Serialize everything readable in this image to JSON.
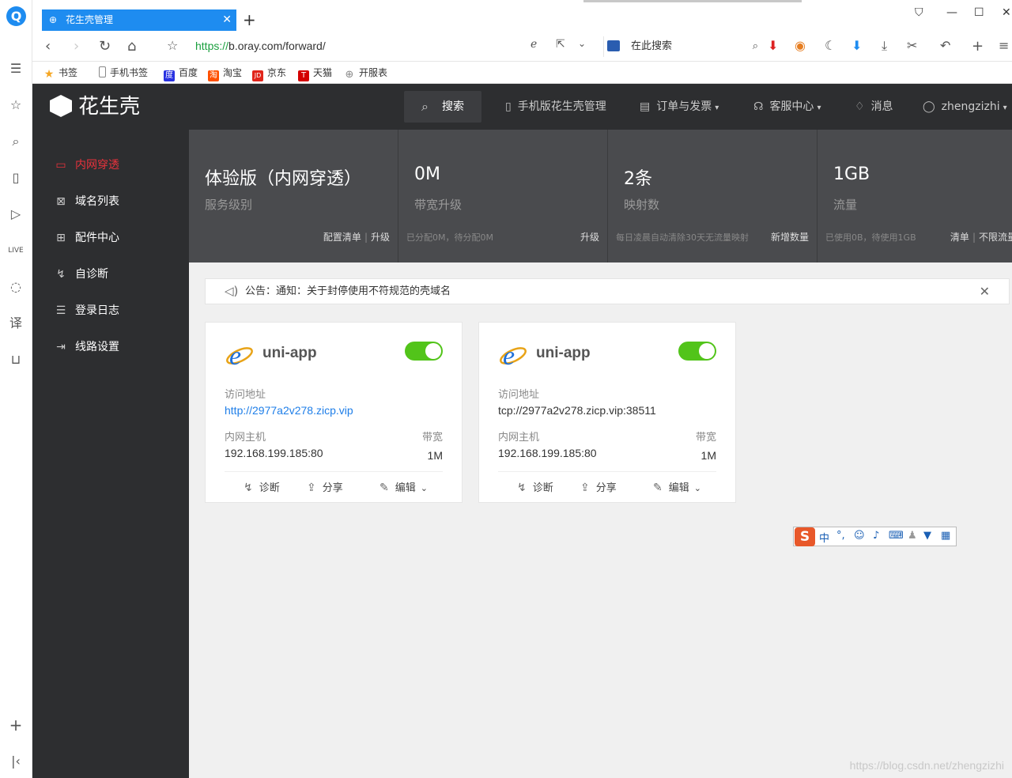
{
  "browser": {
    "tab_title": "花生壳管理",
    "url_scheme": "https://",
    "url_rest": "b.oray.com/forward/",
    "search_placeholder": "在此搜索",
    "bookmarks": [
      {
        "label": "书签",
        "icon": "star-icon",
        "color": "#f5a623"
      },
      {
        "label": "手机书签",
        "icon": "phone-icon",
        "color": "#888888"
      },
      {
        "label": "百度",
        "icon": "baidu-icon",
        "color": "#2932e1"
      },
      {
        "label": "淘宝",
        "icon": "taobao-icon",
        "color": "#ff5000"
      },
      {
        "label": "京东",
        "icon": "jd-icon",
        "color": "#e1251b"
      },
      {
        "label": "天猫",
        "icon": "tmall-icon",
        "color": "#d40000"
      },
      {
        "label": "开服表",
        "icon": "globe-icon",
        "color": "#888888"
      }
    ]
  },
  "header": {
    "brand": "花生壳",
    "search_label": "搜索",
    "items": [
      {
        "label": "手机版花生壳管理",
        "icon": "mobile-icon"
      },
      {
        "label": "订单与发票",
        "icon": "order-icon",
        "dropdown": true
      },
      {
        "label": "客服中心",
        "icon": "headset-icon",
        "dropdown": true
      },
      {
        "label": "消息",
        "icon": "bell-icon"
      },
      {
        "label": "zhengzizhi",
        "icon": "user-icon",
        "dropdown": true
      }
    ]
  },
  "sidebar": {
    "items": [
      {
        "label": "内网穿透",
        "icon": "monitor-icon",
        "active": true
      },
      {
        "label": "域名列表",
        "icon": "domain-icon",
        "active": false
      },
      {
        "label": "配件中心",
        "icon": "grid-icon",
        "active": false
      },
      {
        "label": "自诊断",
        "icon": "diagnose-icon",
        "active": false
      },
      {
        "label": "登录日志",
        "icon": "log-icon",
        "active": false
      },
      {
        "label": "线路设置",
        "icon": "route-icon",
        "active": false
      }
    ]
  },
  "stats": [
    {
      "value": "体验版（内网穿透）",
      "label": "服务级别",
      "footnote": "",
      "actions": [
        "配置清单",
        "升级"
      ]
    },
    {
      "value": "0M",
      "label": "带宽升级",
      "footnote": "已分配0M，待分配0M",
      "actions": [
        "升级"
      ]
    },
    {
      "value": "2条",
      "label": "映射数",
      "footnote": "每日凌晨自动清除30天无流量映射",
      "actions": [
        "新增数量"
      ]
    },
    {
      "value": "1GB",
      "label": "流量",
      "footnote": "已使用0B，待使用1GB",
      "actions": [
        "清单",
        "不限流量"
      ]
    }
  ],
  "notice": {
    "text": "公告：通知：关于封停使用不符规范的壳域名"
  },
  "cards": [
    {
      "title": "uni-app",
      "enabled": true,
      "access_label": "访问地址",
      "access_value": "http://2977a2v278.zicp.vip",
      "access_is_link": true,
      "host_label": "内网主机",
      "host_value": "192.168.199.185:80",
      "bw_label": "带宽",
      "bw_value": "1M",
      "actions": {
        "diagnose": "诊断",
        "share": "分享",
        "edit": "编辑"
      }
    },
    {
      "title": "uni-app",
      "enabled": true,
      "access_label": "访问地址",
      "access_value": "tcp://2977a2v278.zicp.vip:38511",
      "access_is_link": false,
      "host_label": "内网主机",
      "host_value": "192.168.199.185:80",
      "bw_label": "带宽",
      "bw_value": "1M",
      "actions": {
        "diagnose": "诊断",
        "share": "分享",
        "edit": "编辑"
      }
    }
  ],
  "ime": {
    "logo": "S",
    "mode": "中"
  },
  "watermark": "https://blog.csdn.net/zhengzizhi",
  "colors": {
    "accent": "#e8323c",
    "toggle_on": "#52c41a",
    "link": "#1e7ee8",
    "header_bg": "#2d2e30"
  }
}
